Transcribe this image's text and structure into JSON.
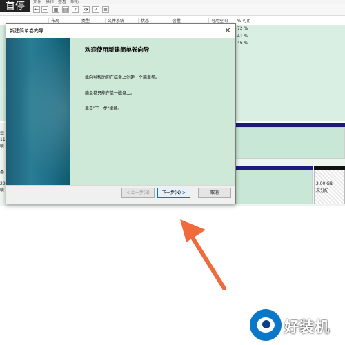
{
  "top_overlay": {
    "label": "首停"
  },
  "menubar": {
    "items": [
      "文件",
      "操作",
      "查看",
      "帮助"
    ]
  },
  "list": {
    "columns": [
      "布局",
      "类型",
      "文件系统",
      "状态",
      "容量",
      "可用空间",
      "% 可用"
    ],
    "rows": [
      {
        "pct": "72 %"
      },
      {
        "pct": "41 %"
      },
      {
        "pct": "46 %"
      }
    ]
  },
  "diskmap": {
    "disk_labels": [
      "基",
      "11",
      "联",
      "基",
      "29",
      "联"
    ],
    "unallocated": {
      "size": "2.00 GB",
      "status": "未分配"
    }
  },
  "dialog": {
    "title": "新建简单卷向导",
    "close_symbol": "×",
    "heading": "欢迎使用新建简单卷向导",
    "paragraphs": [
      "此向导帮助你在磁盘上创建一个简单卷。",
      "简单卷只能在单一磁盘上。",
      "单击\"下一步\"继续。"
    ],
    "buttons": {
      "back": "< 上一步(B)",
      "next": "下一步(N) >",
      "cancel": "取消"
    }
  },
  "watermark": {
    "text": "好装机",
    "sub": "®"
  },
  "colors": {
    "accent_arrow": "#f06a3c",
    "wizard_pane": "#cfe9d9",
    "disk_bar": "#1a1b7c"
  }
}
